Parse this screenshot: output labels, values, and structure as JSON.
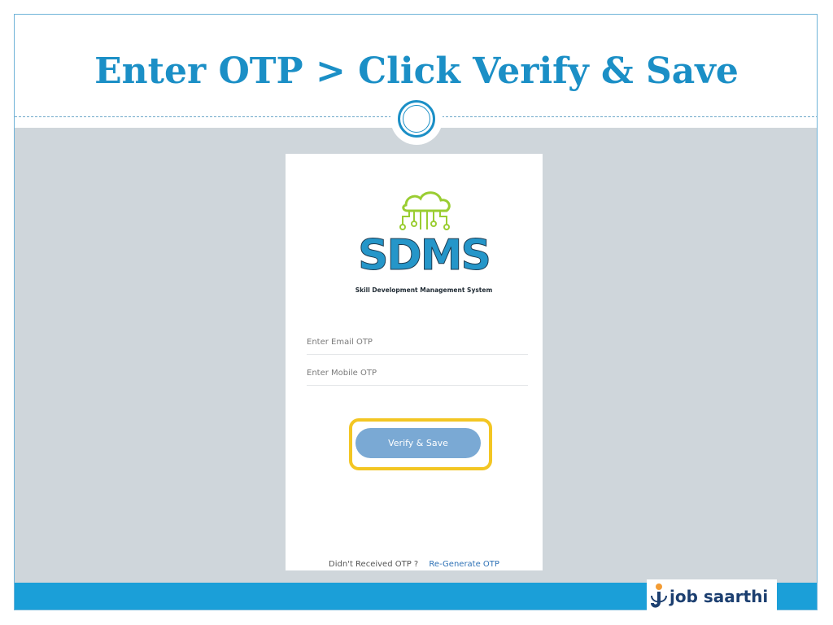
{
  "slide": {
    "title": "Enter OTP > Click Verify & Save"
  },
  "card": {
    "logo": {
      "name": "SDMS",
      "subtitle": "Skill Development Management System"
    },
    "email_otp": {
      "placeholder": "Enter Email OTP",
      "value": ""
    },
    "mobile_otp": {
      "placeholder": "Enter Mobile OTP",
      "value": ""
    },
    "verify_button": "Verify & Save",
    "footer": {
      "question": "Didn't Received OTP ?",
      "link": "Re-Generate OTP"
    }
  },
  "brand": {
    "name": "job saarthi",
    "accent": "#1b8fc6",
    "highlight": "#f3c623",
    "button": "#7aa9d4"
  }
}
